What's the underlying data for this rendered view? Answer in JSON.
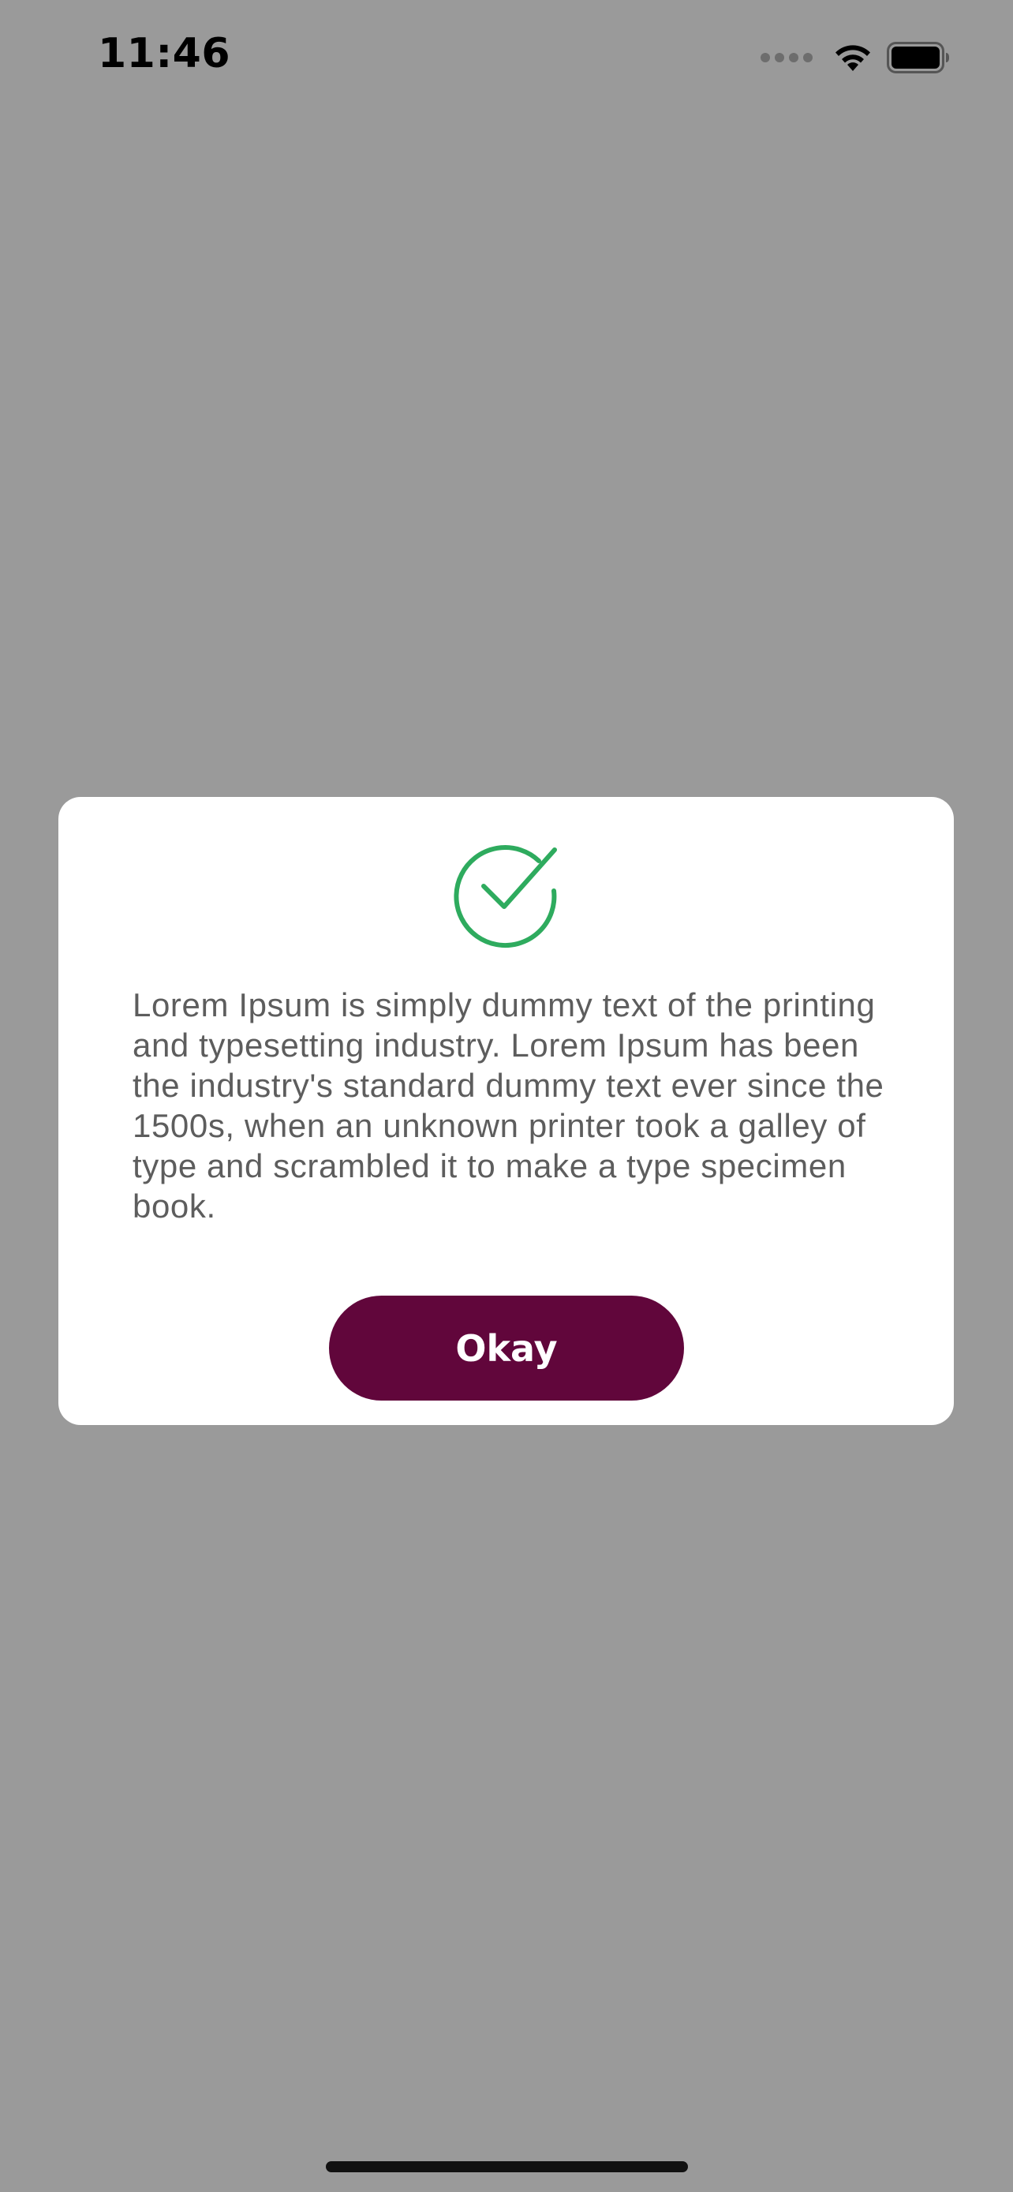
{
  "status_bar": {
    "time": "11:46"
  },
  "icons": {
    "signal": "signal-dots-icon",
    "wifi": "wifi-icon",
    "battery": "battery-icon",
    "success": "check-circle-icon"
  },
  "dialog": {
    "message": "Lorem Ipsum is simply dummy text of the printing and typesetting industry. Lorem Ipsum has been the industry's standard dummy text ever since the 1500s, when an unknown printer took a galley of type and scrambled it to make a type specimen book.",
    "button_label": "Okay"
  },
  "colors": {
    "overlay": "#9a9a9a",
    "success_green": "#2eab5e",
    "button_bg": "#61063b",
    "message_text": "#5d5d5d"
  }
}
